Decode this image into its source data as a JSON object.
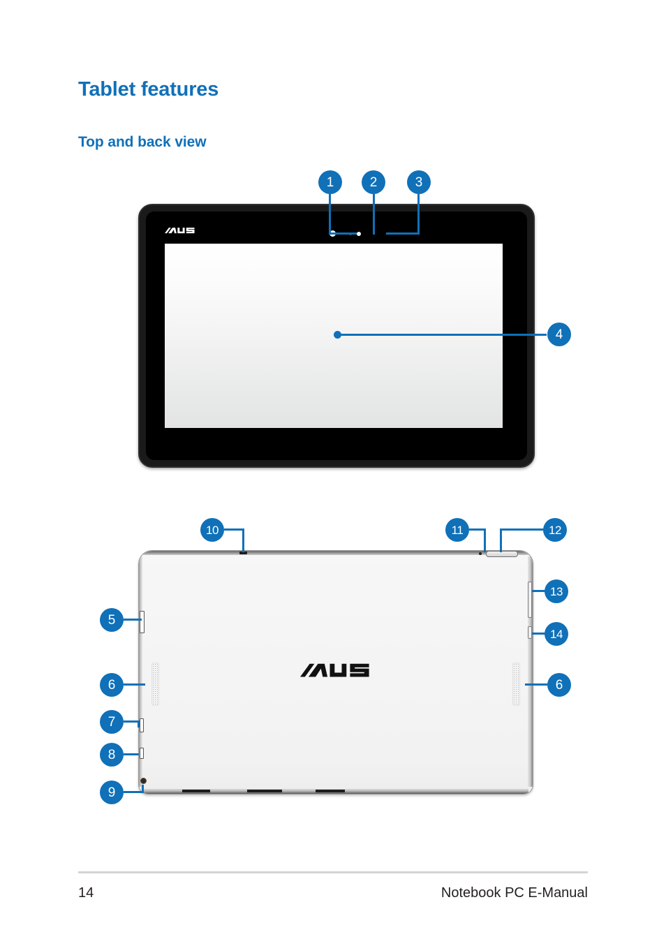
{
  "document": {
    "heading": "Tablet features",
    "subheading": "Top and back view"
  },
  "footer": {
    "page_number": "14",
    "doc_title": "Notebook PC E-Manual",
    "rule_color": "#d4d4d4"
  },
  "theme": {
    "accent_blue": "#1070B8",
    "text_black": "#231f20"
  },
  "figures": {
    "front_view": {
      "brand_logo": "ASUS",
      "callouts": [
        {
          "number": "1",
          "target": "front-camera"
        },
        {
          "number": "2",
          "target": "ambient-light-sensor"
        },
        {
          "number": "3",
          "target": "indicator-dot"
        },
        {
          "number": "4",
          "target": "touch-screen-panel"
        }
      ]
    },
    "back_view": {
      "brand_logo": "ASUS",
      "callouts": [
        {
          "number": "5",
          "target": "left-card-slot"
        },
        {
          "number": "6",
          "target": "left-speaker"
        },
        {
          "number": "7",
          "target": "left-micro-slot"
        },
        {
          "number": "8",
          "target": "left-port"
        },
        {
          "number": "9",
          "target": "audio-jack"
        },
        {
          "number": "10",
          "target": "top-microphone"
        },
        {
          "number": "11",
          "target": "rear-camera-pin"
        },
        {
          "number": "12",
          "target": "top-button"
        },
        {
          "number": "13",
          "target": "volume-button"
        },
        {
          "number": "14",
          "target": "power-button"
        },
        {
          "number": "6",
          "target": "right-speaker"
        }
      ]
    }
  }
}
